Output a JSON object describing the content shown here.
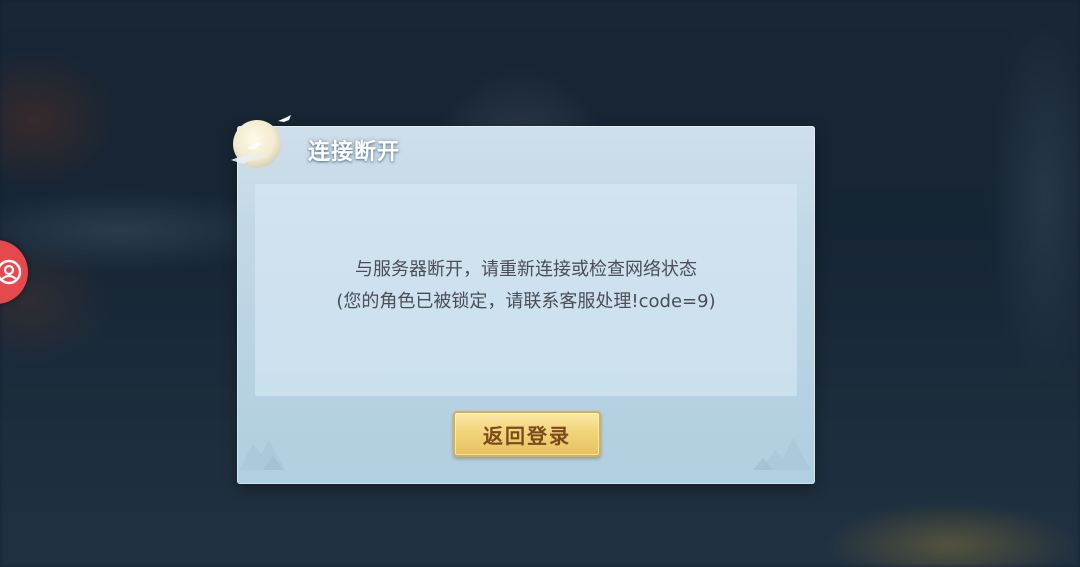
{
  "dialog": {
    "title": "连接断开",
    "message_line_1": "与服务器断开，请重新连接或检查网络状态",
    "message_line_2": "(您的角色已被锁定，请联系客服处理!code=9)",
    "return_button_label": "返回登录"
  },
  "floating_button": {
    "icon": "support-icon",
    "color": "#e5484d"
  },
  "colors": {
    "dialog_background": "#c2d8e6",
    "message_text": "#4a4e57",
    "button_gold": "#f2d47a",
    "button_text": "#7a4a1e"
  }
}
